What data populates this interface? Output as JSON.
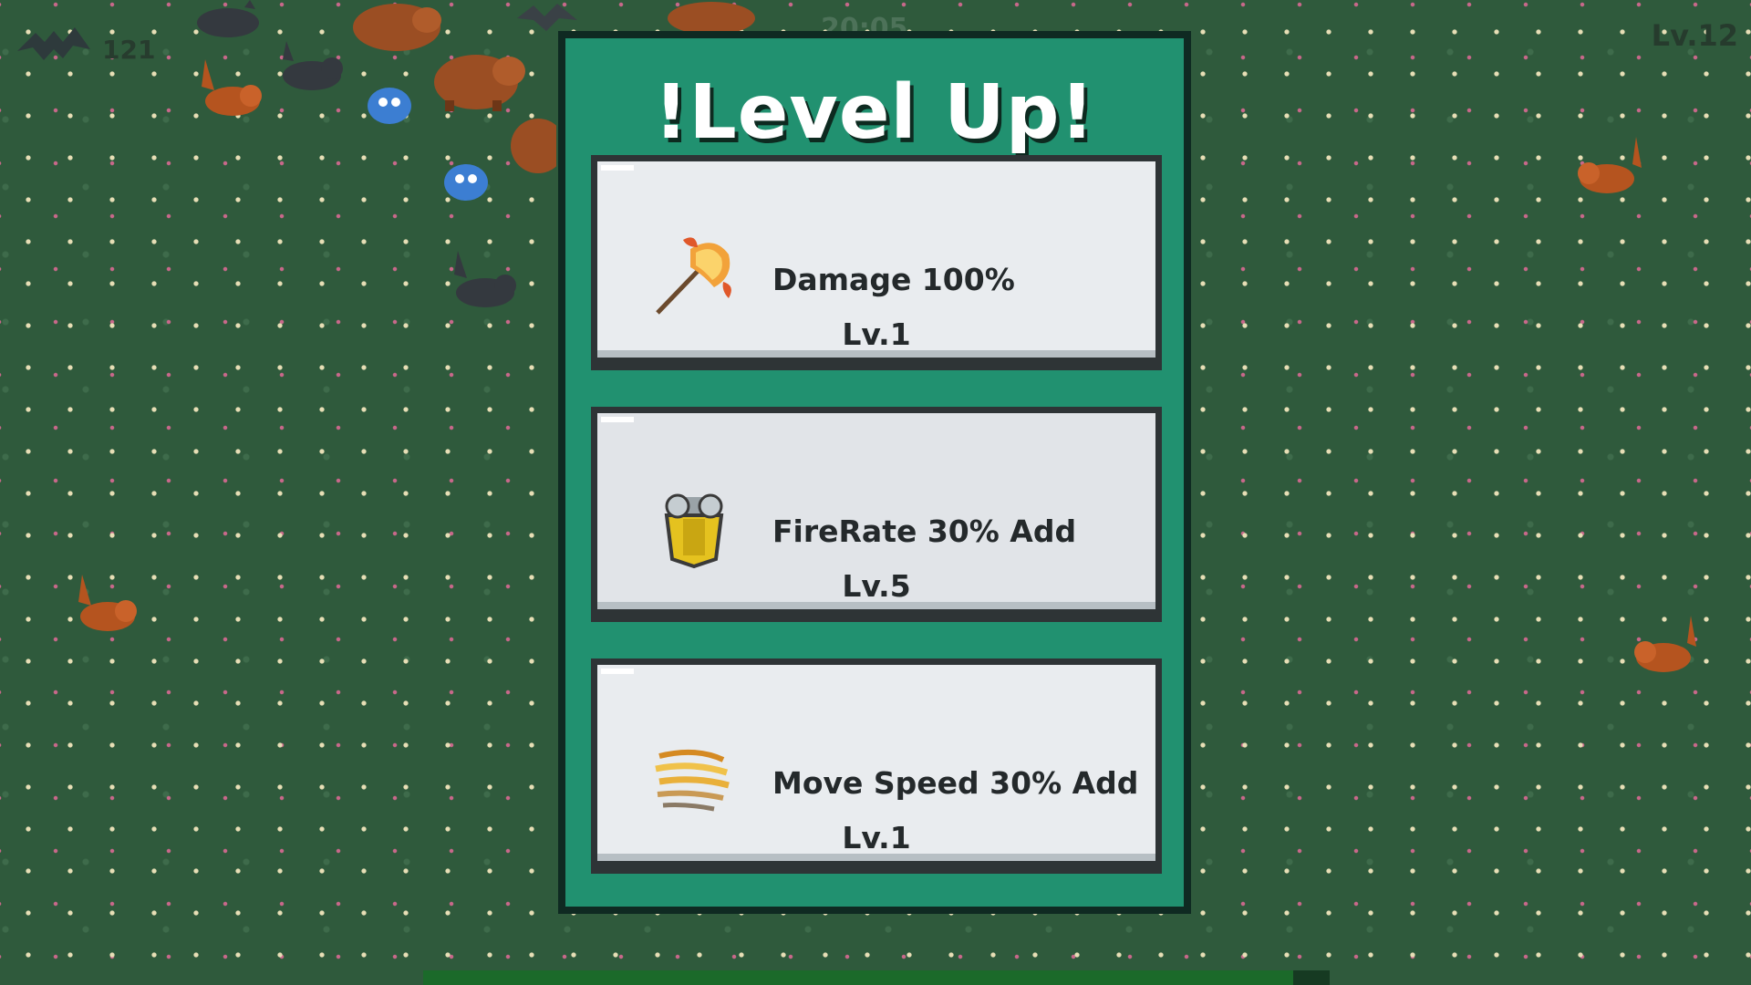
{
  "hud": {
    "kills": "121",
    "player_level": "Lv.12",
    "timer": "20:05"
  },
  "level_up": {
    "title": "!Level Up!",
    "options": [
      {
        "name": "Damage 100%",
        "level": "Lv.1",
        "icon": "flaming-axe-icon"
      },
      {
        "name": "FireRate 30% Add",
        "level": "Lv.5",
        "icon": "armor-icon"
      },
      {
        "name": "Move Speed 30% Add",
        "level": "Lv.1",
        "icon": "speed-wind-icon"
      }
    ]
  },
  "xp": {
    "progress": 0.96
  },
  "colors": {
    "panel": "#219170",
    "panel_border": "#0f2a22",
    "card": "#e9ecef",
    "grass": "#2f5a3c"
  }
}
